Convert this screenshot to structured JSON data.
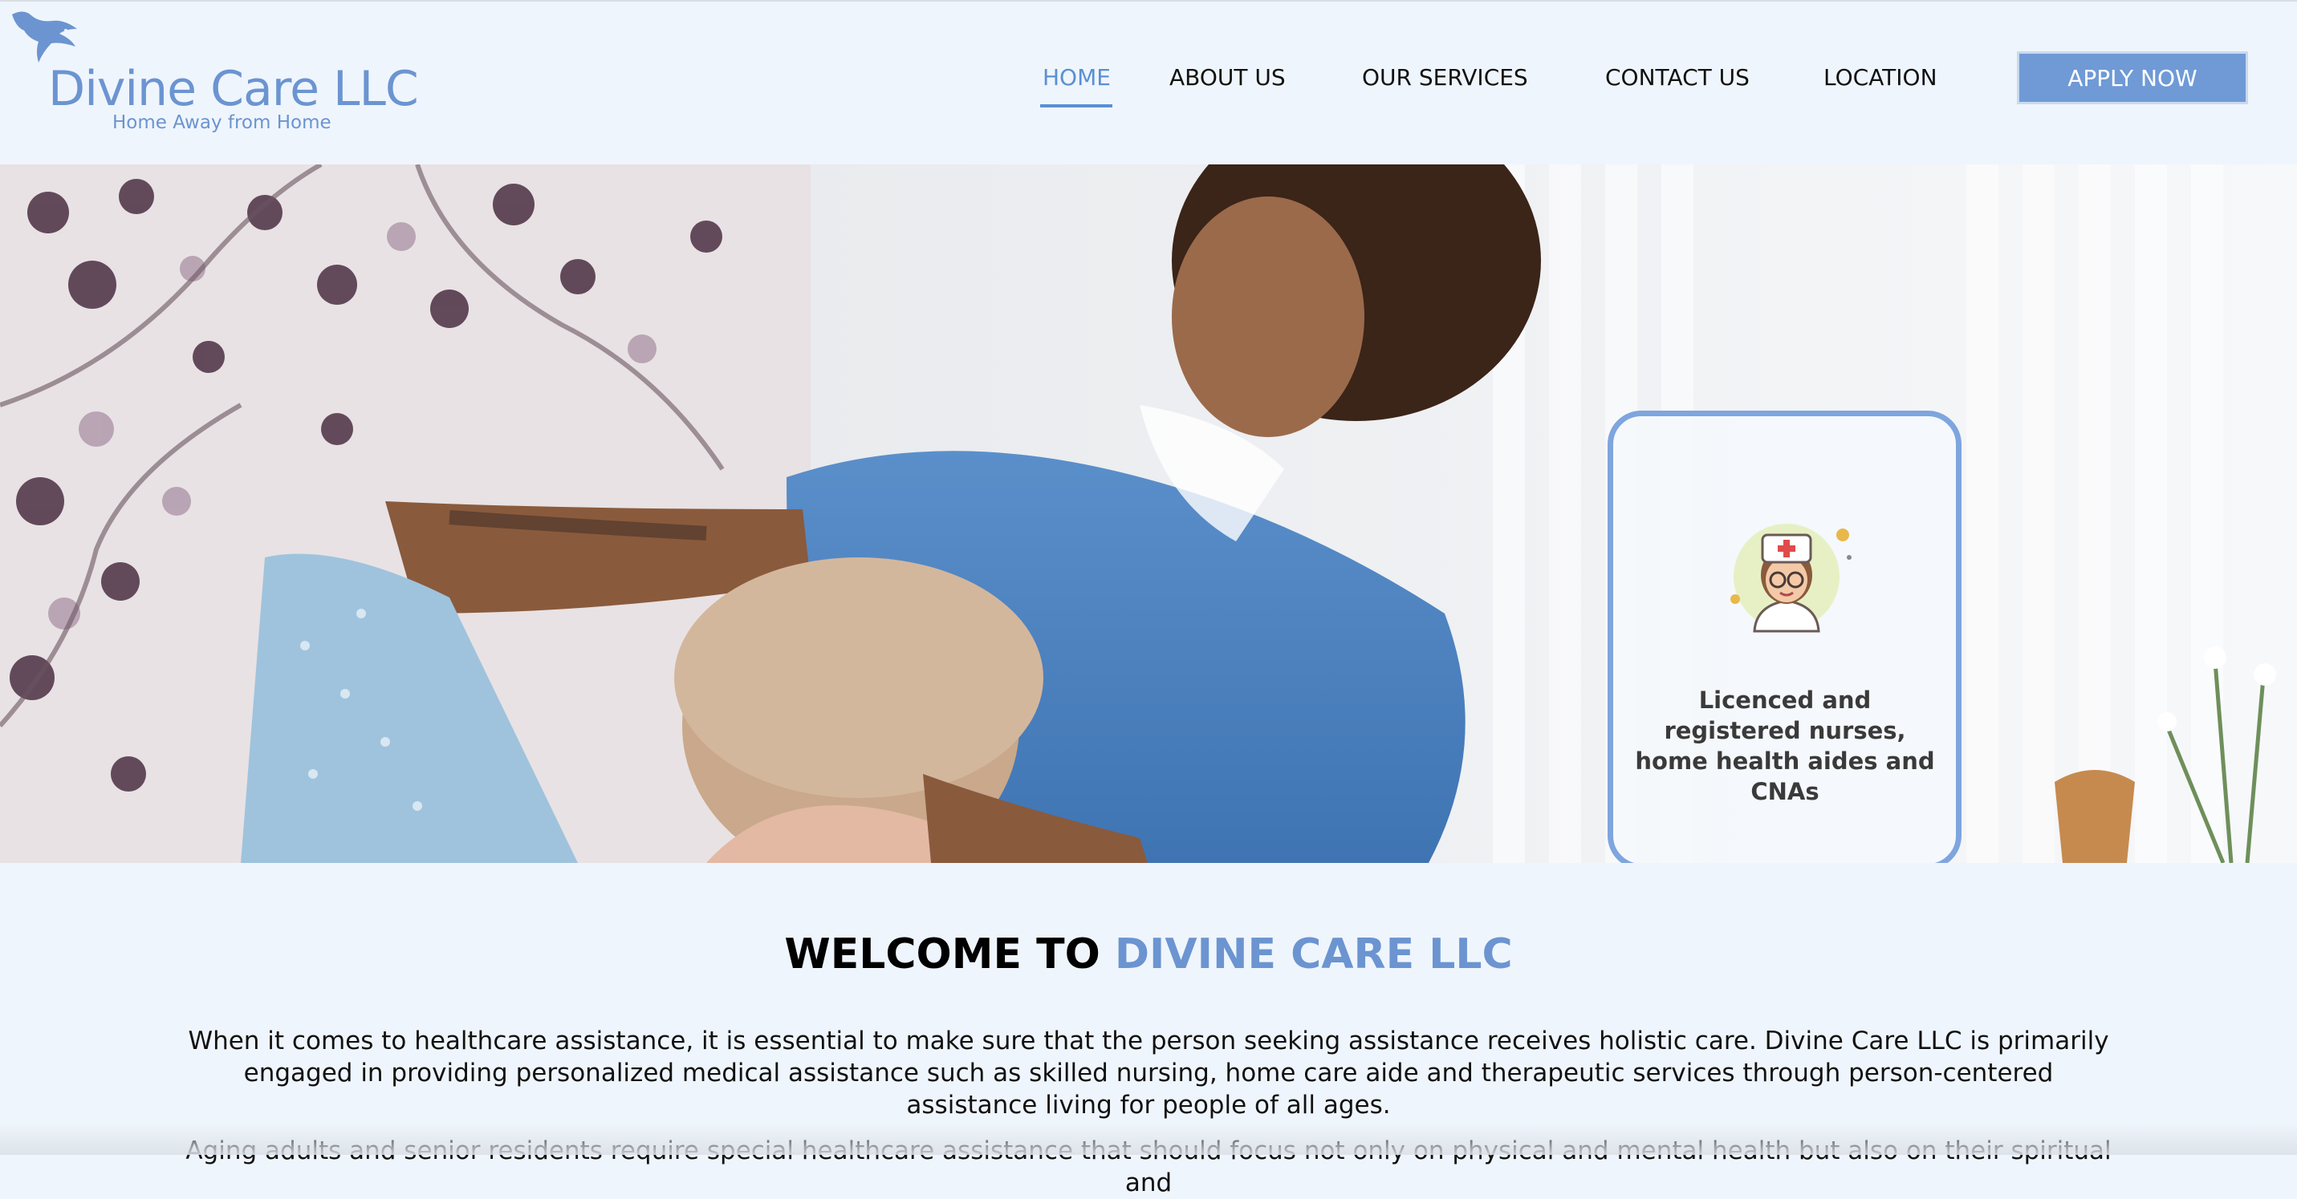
{
  "brand": {
    "name": "Divine Care LLC",
    "tagline": "Home Away from Home",
    "logo_icon": "eagle-icon",
    "accent_color": "#6b94d1"
  },
  "nav": {
    "items": [
      {
        "label": "HOME",
        "active": true
      },
      {
        "label": "ABOUT US",
        "active": false
      },
      {
        "label": "OUR SERVICES",
        "active": false
      },
      {
        "label": "CONTACT US",
        "active": false
      },
      {
        "label": "LOCATION",
        "active": false
      }
    ],
    "apply_label": "APPLY NOW"
  },
  "hero": {
    "image": "caregiver-helping-senior-woman-photo",
    "card": {
      "icon": "nurse-icon",
      "text": "Licenced and registered nurses, home health aides and CNAs"
    },
    "carousel": {
      "slide_count": 4,
      "active_slide": 3
    }
  },
  "welcome": {
    "prefix": "WELCOME TO ",
    "highlight": "DIVINE CARE LLC",
    "paragraph1": "When it comes to healthcare assistance, it is essential to make sure that the person seeking assistance receives holistic care. Divine Care LLC is primarily engaged in providing personalized medical assistance such as skilled nursing, home care aide and therapeutic services through person-centered assistance living for people of all ages.",
    "paragraph2": "Aging adults and senior residents require special healthcare assistance that should focus not only on physical and mental health but also on their spiritual and"
  }
}
